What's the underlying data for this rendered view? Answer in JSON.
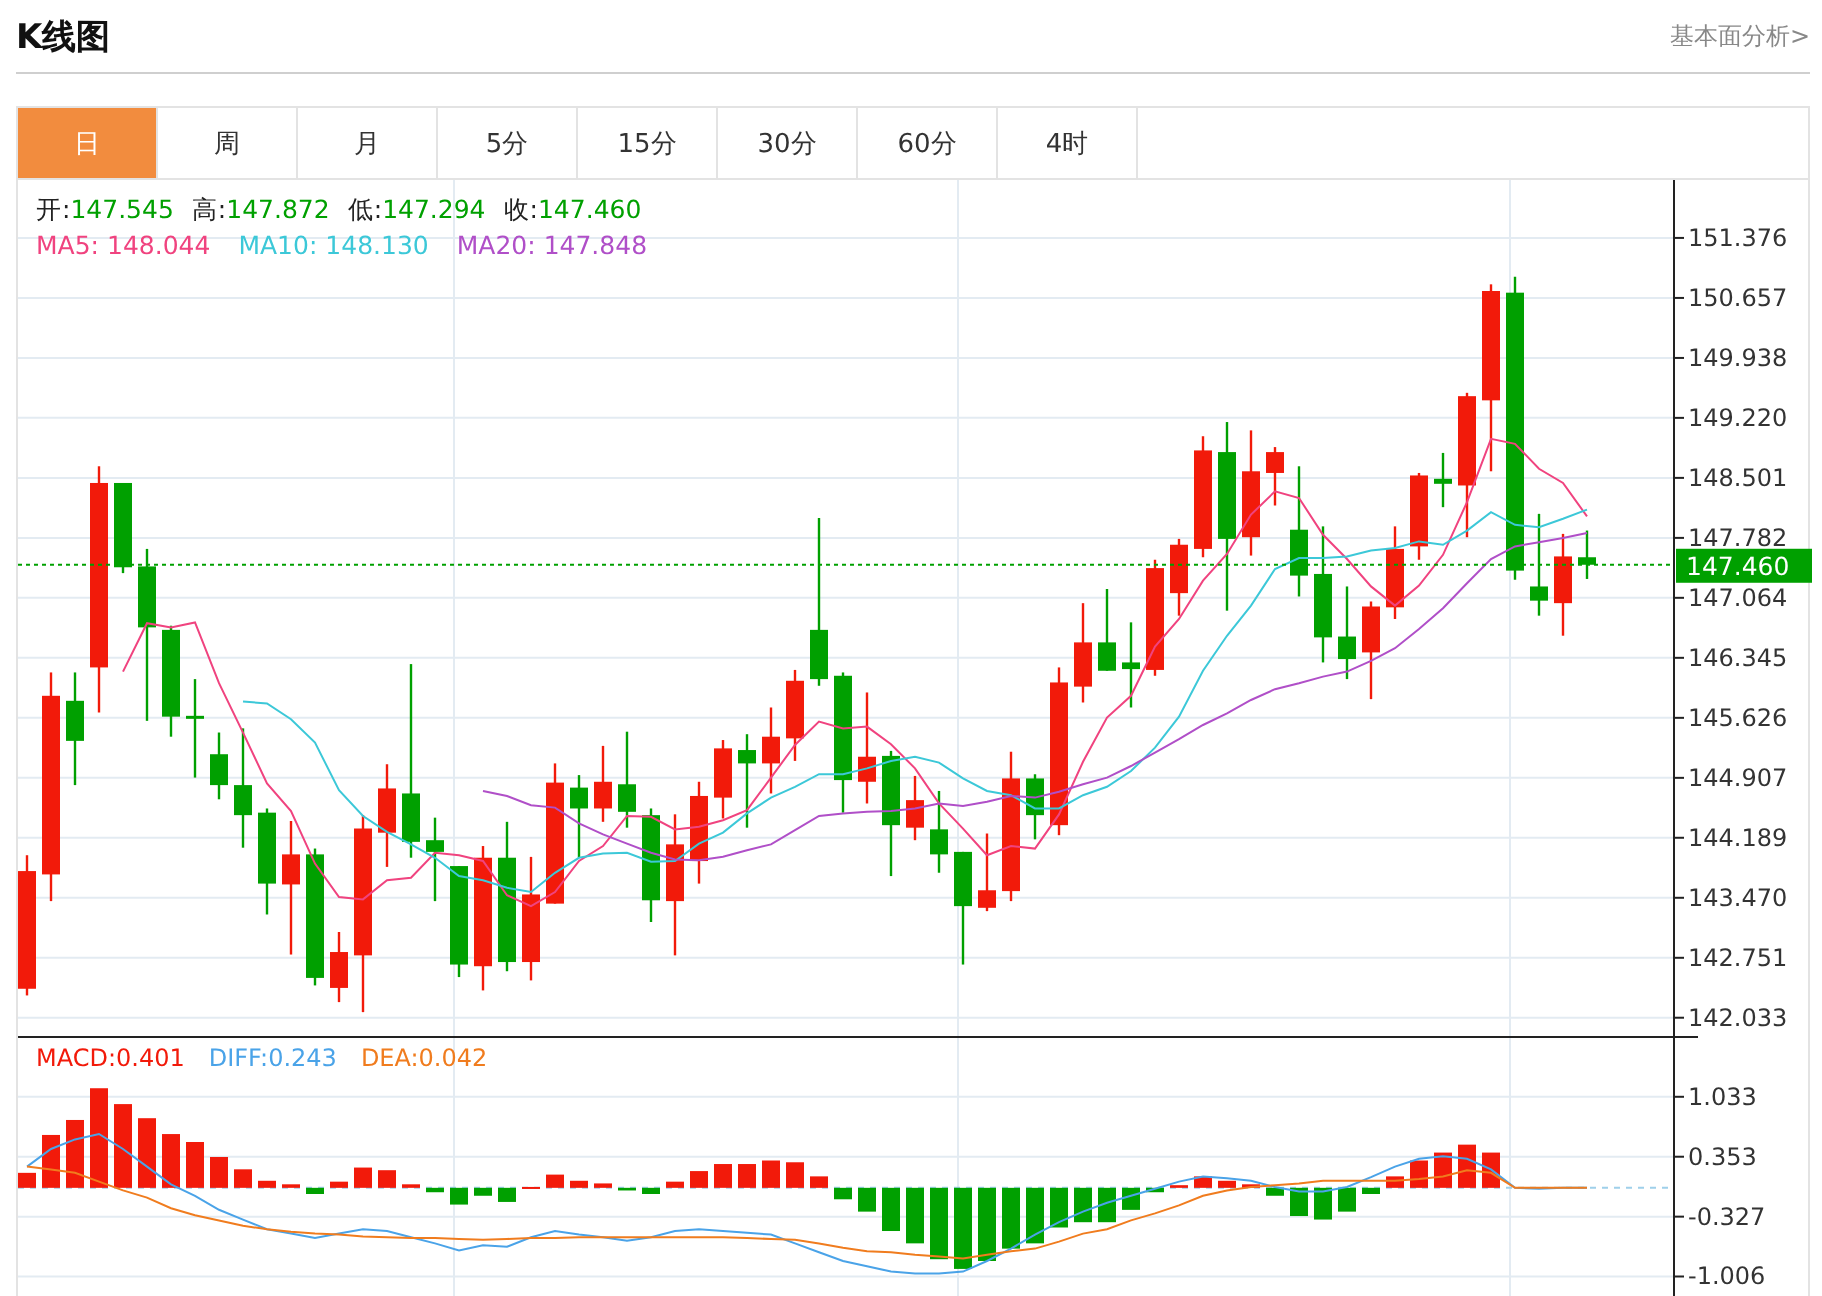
{
  "header": {
    "title": "K线图",
    "link": "基本面分析>"
  },
  "tabs": [
    {
      "label": "日",
      "selected": true
    },
    {
      "label": "周",
      "selected": false
    },
    {
      "label": "月",
      "selected": false
    },
    {
      "label": "5分",
      "selected": false
    },
    {
      "label": "15分",
      "selected": false
    },
    {
      "label": "30分",
      "selected": false
    },
    {
      "label": "60分",
      "selected": false
    },
    {
      "label": "4时",
      "selected": false
    }
  ],
  "kline": {
    "ohlc_legend": [
      {
        "label": "开:",
        "value": "147.545"
      },
      {
        "label": "高:",
        "value": "147.872"
      },
      {
        "label": "低:",
        "value": "147.294"
      },
      {
        "label": "收:",
        "value": "147.460"
      }
    ],
    "ma_legend": [
      {
        "sep": ":",
        "value": "148.044"
      },
      {
        "sep": ":",
        "value": "148.130"
      },
      {
        "sep": ":",
        "value": "147.848"
      }
    ],
    "chart_data": {
      "type": "candlestick",
      "grid": true,
      "ylim": [
        141.79,
        152.07
      ],
      "categories": [
        null,
        null,
        null,
        null,
        null,
        null,
        null,
        null,
        null,
        null,
        null,
        null,
        null,
        null,
        null,
        null,
        null,
        null,
        null,
        null,
        null,
        null,
        null,
        null,
        null,
        null,
        null,
        null,
        null,
        null,
        null,
        null,
        null,
        null,
        null,
        null,
        null,
        null,
        null,
        null,
        null,
        null,
        null,
        null,
        null,
        null,
        null,
        null,
        null,
        null,
        null,
        null,
        null,
        null,
        null,
        null,
        null,
        null,
        null,
        null,
        null,
        null,
        null,
        null,
        null,
        null
      ],
      "ohlc": [
        [
          142.38,
          143.98,
          142.3,
          143.79
        ],
        [
          143.75,
          146.17,
          143.43,
          145.89
        ],
        [
          145.83,
          146.17,
          144.82,
          145.35
        ],
        [
          146.23,
          148.64,
          145.69,
          148.44
        ],
        [
          148.44,
          148.44,
          147.36,
          147.43
        ],
        [
          147.44,
          147.65,
          145.59,
          146.71
        ],
        [
          146.68,
          146.73,
          145.4,
          145.64
        ],
        [
          145.65,
          146.09,
          144.91,
          145.62
        ],
        [
          145.19,
          145.45,
          144.65,
          144.82
        ],
        [
          144.82,
          145.5,
          144.07,
          144.46
        ],
        [
          144.49,
          144.54,
          143.27,
          143.64
        ],
        [
          143.63,
          144.39,
          142.79,
          143.99
        ],
        [
          143.99,
          144.06,
          142.42,
          142.51
        ],
        [
          142.39,
          143.06,
          142.22,
          142.82
        ],
        [
          142.78,
          144.46,
          142.1,
          144.3
        ],
        [
          144.25,
          145.07,
          143.84,
          144.78
        ],
        [
          144.72,
          146.27,
          143.95,
          144.14
        ],
        [
          144.16,
          144.43,
          143.43,
          144.02
        ],
        [
          143.85,
          143.85,
          142.52,
          142.67
        ],
        [
          142.65,
          144.09,
          142.36,
          143.95
        ],
        [
          143.95,
          144.38,
          142.59,
          142.7
        ],
        [
          142.7,
          143.96,
          142.48,
          143.51
        ],
        [
          143.4,
          145.08,
          143.4,
          144.85
        ],
        [
          144.79,
          144.94,
          143.95,
          144.54
        ],
        [
          144.54,
          145.29,
          144.38,
          144.86
        ],
        [
          144.83,
          145.46,
          144.31,
          144.5
        ],
        [
          144.46,
          144.54,
          143.18,
          143.44
        ],
        [
          143.43,
          144.47,
          142.78,
          144.11
        ],
        [
          143.91,
          144.86,
          143.64,
          144.69
        ],
        [
          144.67,
          145.36,
          144.42,
          145.26
        ],
        [
          145.24,
          145.43,
          144.31,
          145.08
        ],
        [
          145.08,
          145.75,
          144.72,
          145.4
        ],
        [
          145.38,
          146.2,
          145.11,
          146.07
        ],
        [
          146.68,
          148.02,
          146.01,
          146.09
        ],
        [
          146.13,
          146.17,
          144.49,
          144.88
        ],
        [
          144.86,
          145.93,
          144.6,
          145.16
        ],
        [
          145.17,
          145.23,
          143.73,
          144.34
        ],
        [
          144.31,
          144.93,
          144.16,
          144.64
        ],
        [
          144.29,
          144.75,
          143.77,
          143.99
        ],
        [
          144.02,
          144.02,
          142.67,
          143.37
        ],
        [
          143.35,
          144.24,
          143.31,
          143.56
        ],
        [
          143.55,
          145.22,
          143.43,
          144.9
        ],
        [
          144.9,
          144.95,
          144.17,
          144.46
        ],
        [
          144.34,
          146.23,
          144.22,
          146.05
        ],
        [
          146.0,
          147.0,
          145.81,
          146.53
        ],
        [
          146.53,
          147.17,
          146.19,
          146.19
        ],
        [
          146.29,
          146.77,
          145.75,
          146.21
        ],
        [
          146.2,
          147.52,
          146.13,
          147.42
        ],
        [
          147.12,
          147.77,
          146.85,
          147.7
        ],
        [
          147.65,
          149.0,
          147.55,
          148.83
        ],
        [
          148.81,
          149.17,
          146.91,
          147.77
        ],
        [
          147.79,
          149.07,
          147.57,
          148.58
        ],
        [
          148.56,
          148.87,
          148.17,
          148.81
        ],
        [
          147.88,
          148.64,
          147.08,
          147.33
        ],
        [
          147.35,
          147.92,
          146.29,
          146.59
        ],
        [
          146.6,
          147.2,
          146.09,
          146.33
        ],
        [
          146.41,
          147.02,
          145.85,
          146.96
        ],
        [
          146.95,
          147.92,
          146.81,
          147.65
        ],
        [
          147.68,
          148.56,
          147.52,
          148.53
        ],
        [
          148.49,
          148.8,
          148.15,
          148.43
        ],
        [
          148.41,
          149.52,
          147.79,
          149.48
        ],
        [
          149.43,
          150.82,
          148.58,
          150.74
        ],
        [
          150.72,
          150.91,
          147.28,
          147.39
        ],
        [
          147.2,
          148.07,
          146.85,
          147.03
        ],
        [
          147.0,
          147.83,
          146.61,
          147.56
        ],
        [
          147.55,
          147.87,
          147.29,
          147.46
        ]
      ],
      "yticks": [
        142.033,
        142.751,
        {
          "value": 143.47,
          "label": "143.470"
        },
        144.189,
        144.907,
        145.626,
        146.345,
        147.064,
        147.782,
        148.501,
        {
          "value": 149.22,
          "label": "149.220"
        },
        149.938,
        150.657,
        151.376
      ],
      "ref_lines": [
        {
          "axis": "y",
          "value": 147.46,
          "label": "147.460",
          "color": "#00a000"
        }
      ],
      "series": [
        {
          "name": "MA5",
          "type": "line",
          "color": "#f0437f",
          "values": [
            null,
            null,
            null,
            null,
            146.18,
            146.76,
            146.71,
            146.77,
            146.04,
            145.45,
            144.84,
            144.51,
            143.88,
            143.48,
            143.45,
            143.68,
            143.71,
            144.01,
            143.98,
            143.91,
            143.5,
            143.37,
            143.54,
            143.91,
            144.09,
            144.45,
            144.44,
            144.29,
            144.32,
            144.4,
            144.52,
            144.91,
            145.3,
            145.58,
            145.5,
            145.52,
            145.31,
            145.02,
            144.6,
            144.3,
            143.98,
            144.09,
            144.06,
            144.47,
            145.1,
            145.63,
            145.89,
            146.48,
            146.81,
            147.27,
            147.59,
            148.06,
            148.34,
            148.26,
            147.82,
            147.53,
            147.2,
            146.97,
            147.21,
            147.58,
            148.21,
            148.97,
            148.91,
            148.61,
            148.44,
            148.04
          ]
        },
        {
          "name": "MA10",
          "type": "line",
          "color": "#3cc8d8",
          "values": [
            null,
            null,
            null,
            null,
            null,
            null,
            null,
            null,
            null,
            145.82,
            145.8,
            145.61,
            145.33,
            144.76,
            144.45,
            144.26,
            144.11,
            143.95,
            143.73,
            143.68,
            143.59,
            143.54,
            143.77,
            143.95,
            144.0,
            144.01,
            143.9,
            143.91,
            144.12,
            144.25,
            144.48,
            144.67,
            144.8,
            144.95,
            144.95,
            145.02,
            145.11,
            145.16,
            145.09,
            144.9,
            144.75,
            144.7,
            144.54,
            144.54,
            144.7,
            144.8,
            144.99,
            145.27,
            145.64,
            146.19,
            146.61,
            146.97,
            147.41,
            147.54,
            147.54,
            147.56,
            147.63,
            147.66,
            147.74,
            147.7,
            147.87,
            148.09,
            147.94,
            147.91,
            148.01,
            148.12
          ]
        },
        {
          "name": "MA20",
          "type": "line",
          "color": "#b04fc8",
          "values": [
            null,
            null,
            null,
            null,
            null,
            null,
            null,
            null,
            null,
            null,
            null,
            null,
            null,
            null,
            null,
            null,
            null,
            null,
            null,
            144.75,
            144.69,
            144.58,
            144.55,
            144.36,
            144.23,
            144.12,
            144.01,
            143.93,
            143.92,
            143.96,
            144.04,
            144.11,
            144.28,
            144.45,
            144.48,
            144.5,
            144.51,
            144.54,
            144.6,
            144.57,
            144.62,
            144.69,
            144.67,
            144.74,
            144.83,
            144.91,
            145.05,
            145.21,
            145.37,
            145.54,
            145.68,
            145.84,
            145.97,
            146.04,
            146.12,
            146.18,
            146.31,
            146.46,
            146.69,
            146.94,
            147.24,
            147.53,
            147.68,
            147.73,
            147.78,
            147.84
          ]
        }
      ]
    }
  },
  "macd": {
    "legend": [
      {
        "sep": ":",
        "value": "0.401"
      },
      {
        "sep": ":",
        "value": "0.243"
      },
      {
        "sep": ":",
        "value": "0.042"
      }
    ],
    "chart_data": {
      "type": "bar",
      "grid": true,
      "ylim": [
        -1.25,
        1.7
      ],
      "yticks": [
        -1.006,
        -0.327,
        0.353,
        1.033
      ],
      "ref_lines": [
        {
          "axis": "y",
          "value": 0,
          "color": "#9fd0ea"
        }
      ],
      "series": [
        {
          "name": "MACD",
          "color": "#f21a0a",
          "colors": [
            "#f21a0a",
            "#f21a0a",
            "#f21a0a",
            "#f21a0a",
            "#f21a0a",
            "#f21a0a",
            "#f21a0a",
            "#f21a0a",
            "#f21a0a",
            "#f21a0a",
            "#f21a0a",
            "#f21a0a",
            "#00a000",
            "#f21a0a",
            "#f21a0a",
            "#f21a0a",
            "#f21a0a",
            "#00a000",
            "#00a000",
            "#00a000",
            "#00a000",
            "#f21a0a",
            "#f21a0a",
            "#f21a0a",
            "#f21a0a",
            "#00a000",
            "#00a000",
            "#f21a0a",
            "#f21a0a",
            "#f21a0a",
            "#f21a0a",
            "#f21a0a",
            "#f21a0a",
            "#f21a0a",
            "#00a000",
            "#00a000",
            "#00a000",
            "#00a000",
            "#00a000",
            "#00a000",
            "#00a000",
            "#00a000",
            "#00a000",
            "#00a000",
            "#00a000",
            "#00a000",
            "#00a000",
            "#00a000",
            "#f21a0a",
            "#f21a0a",
            "#f21a0a",
            "#f21a0a",
            "#00a000",
            "#00a000",
            "#00a000",
            "#00a000",
            "#00a000",
            "#f21a0a",
            "#f21a0a",
            "#f21a0a",
            "#f21a0a",
            "#f21a0a",
            null,
            null,
            null,
            null
          ],
          "values": [
            0.17,
            0.6,
            0.77,
            1.13,
            0.95,
            0.79,
            0.61,
            0.52,
            0.35,
            0.21,
            0.08,
            0.04,
            -0.07,
            0.07,
            0.23,
            0.2,
            0.04,
            -0.05,
            -0.19,
            -0.09,
            -0.16,
            0.01,
            0.15,
            0.08,
            0.05,
            -0.03,
            -0.07,
            0.07,
            0.19,
            0.27,
            0.27,
            0.31,
            0.29,
            0.13,
            -0.13,
            -0.27,
            -0.49,
            -0.63,
            -0.81,
            -0.92,
            -0.83,
            -0.69,
            -0.63,
            -0.45,
            -0.39,
            -0.39,
            -0.25,
            -0.05,
            0.03,
            0.13,
            0.08,
            0.04,
            -0.09,
            -0.32,
            -0.36,
            -0.27,
            -0.07,
            0.13,
            0.31,
            0.4,
            0.49,
            0.4,
            null,
            null,
            null,
            null
          ]
        },
        {
          "name": "DIFF",
          "type": "line",
          "color": "#4aa3e8",
          "values": [
            0.24,
            0.44,
            0.55,
            0.61,
            0.44,
            0.24,
            0.04,
            -0.09,
            -0.25,
            -0.36,
            -0.47,
            -0.52,
            -0.57,
            -0.52,
            -0.47,
            -0.49,
            -0.56,
            -0.63,
            -0.71,
            -0.65,
            -0.67,
            -0.56,
            -0.49,
            -0.53,
            -0.56,
            -0.6,
            -0.56,
            -0.49,
            -0.47,
            -0.49,
            -0.51,
            -0.53,
            -0.63,
            -0.73,
            -0.83,
            -0.89,
            -0.95,
            -0.97,
            -0.97,
            -0.95,
            -0.83,
            -0.69,
            -0.53,
            -0.39,
            -0.27,
            -0.17,
            -0.09,
            -0.01,
            0.07,
            0.13,
            0.11,
            0.08,
            0.01,
            -0.04,
            -0.04,
            0.01,
            0.12,
            0.24,
            0.33,
            0.36,
            0.33,
            0.21,
            0.0,
            -0.01,
            0.0,
            0.0
          ]
        },
        {
          "name": "DEA",
          "type": "line",
          "color": "#f07c1e",
          "values": [
            0.24,
            0.21,
            0.17,
            0.07,
            -0.03,
            -0.11,
            -0.23,
            -0.31,
            -0.37,
            -0.43,
            -0.47,
            -0.5,
            -0.52,
            -0.53,
            -0.55,
            -0.56,
            -0.57,
            -0.57,
            -0.58,
            -0.59,
            -0.58,
            -0.57,
            -0.57,
            -0.56,
            -0.56,
            -0.56,
            -0.56,
            -0.56,
            -0.56,
            -0.56,
            -0.57,
            -0.58,
            -0.59,
            -0.63,
            -0.68,
            -0.72,
            -0.73,
            -0.76,
            -0.78,
            -0.8,
            -0.76,
            -0.72,
            -0.69,
            -0.61,
            -0.52,
            -0.47,
            -0.37,
            -0.29,
            -0.2,
            -0.09,
            -0.03,
            0.01,
            0.03,
            0.05,
            0.08,
            0.08,
            0.08,
            0.08,
            0.1,
            0.13,
            0.2,
            0.17,
            0.0,
            0.0,
            0.0,
            0.0
          ]
        }
      ]
    }
  }
}
